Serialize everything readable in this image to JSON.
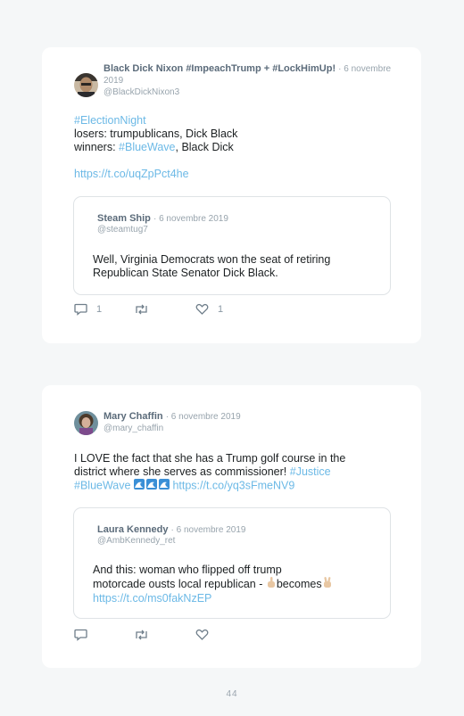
{
  "tweets": [
    {
      "author_name": "Black Dick Nixon #ImpeachTrump + #LockHimUp!",
      "date": "· 6 novembre 2019",
      "handle": "@BlackDickNixon3",
      "hashtag": "#ElectionNight",
      "line2": "losers: trumpublicans, Dick Black",
      "line3_prefix": "winners: ",
      "line3_hashtag": "#BlueWave",
      "line3_suffix": ", Black Dick",
      "link": "https://t.co/uqZpPct4he",
      "quote": {
        "author_name": "Steam Ship",
        "date": "· 6 novembre 2019",
        "handle": "@steamtug7",
        "text": "Well, Virginia Democrats won the seat of retiring Republican State Senator Dick Black."
      },
      "reply_count": "1",
      "like_count": "1"
    },
    {
      "author_name": "Mary Chaffin",
      "date": "· 6 novembre 2019",
      "handle": "@mary_chaffin",
      "text_main": "I LOVE the fact that she has a Trump golf course in the district where she serves as commissioner! ",
      "hashtag1": "#Justice",
      "hashtag2": "#BlueWave",
      "link": "https://t.co/yq3sFmeNV9",
      "quote": {
        "author_name": "Laura Kennedy",
        "date": "· 6 novembre 2019",
        "handle": "@AmbKennedy_ret",
        "text_prefix": "And this: woman who flipped off trump motorcade ousts local republican - ",
        "text_middle": "becomes",
        "link": "https://t.co/ms0fakNzEP"
      }
    }
  ],
  "page_number": "44",
  "colors": {
    "link": "#6cb9e6",
    "name": "#5b6b7a",
    "meta": "#98a4ad",
    "background": "#f5f7f8"
  }
}
